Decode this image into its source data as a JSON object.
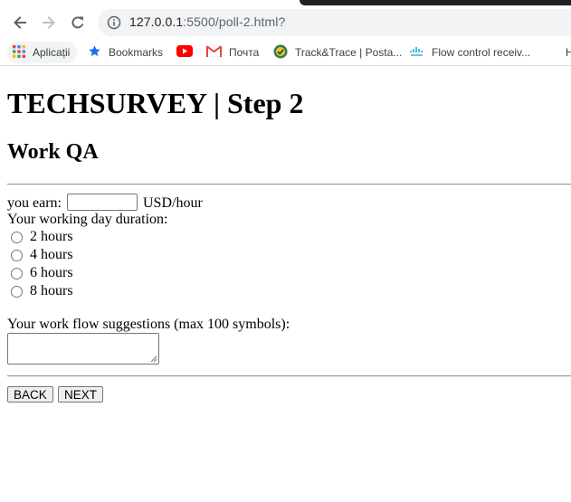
{
  "browser": {
    "url_host": "127.0.0.1",
    "url_path": ":5500/poll-2.html?",
    "bookmarks": [
      {
        "label": "Aplicații",
        "icon": "apps-grid-icon"
      },
      {
        "label": "Bookmarks",
        "icon": "star-icon"
      },
      {
        "label": "",
        "icon": "youtube-icon"
      },
      {
        "label": "Почта",
        "icon": "gmail-icon"
      },
      {
        "label": "Track&Trace | Posta...",
        "icon": "track-trace-icon"
      },
      {
        "label": "Flow control receiv...",
        "icon": "cisco-icon"
      },
      {
        "label": "H",
        "icon": ""
      }
    ]
  },
  "page": {
    "title": "TECHSURVEY | Step 2",
    "subtitle": "Work QA",
    "earn_label": "you earn:",
    "earn_value": "",
    "earn_unit": "USD/hour",
    "duration_label": "Your working day duration:",
    "duration_options": [
      "2 hours",
      "4 hours",
      "6 hours",
      "8 hours"
    ],
    "suggestions_label": "Your work flow suggestions (max 100 symbols):",
    "suggestions_value": "",
    "back_label": "BACK",
    "next_label": "NEXT"
  },
  "colors": {
    "chrome_dark": "#202124",
    "omnibox_bg": "#f1f3f4",
    "youtube_red": "#ff0000",
    "bookmarks_star": "#1a73e8"
  }
}
